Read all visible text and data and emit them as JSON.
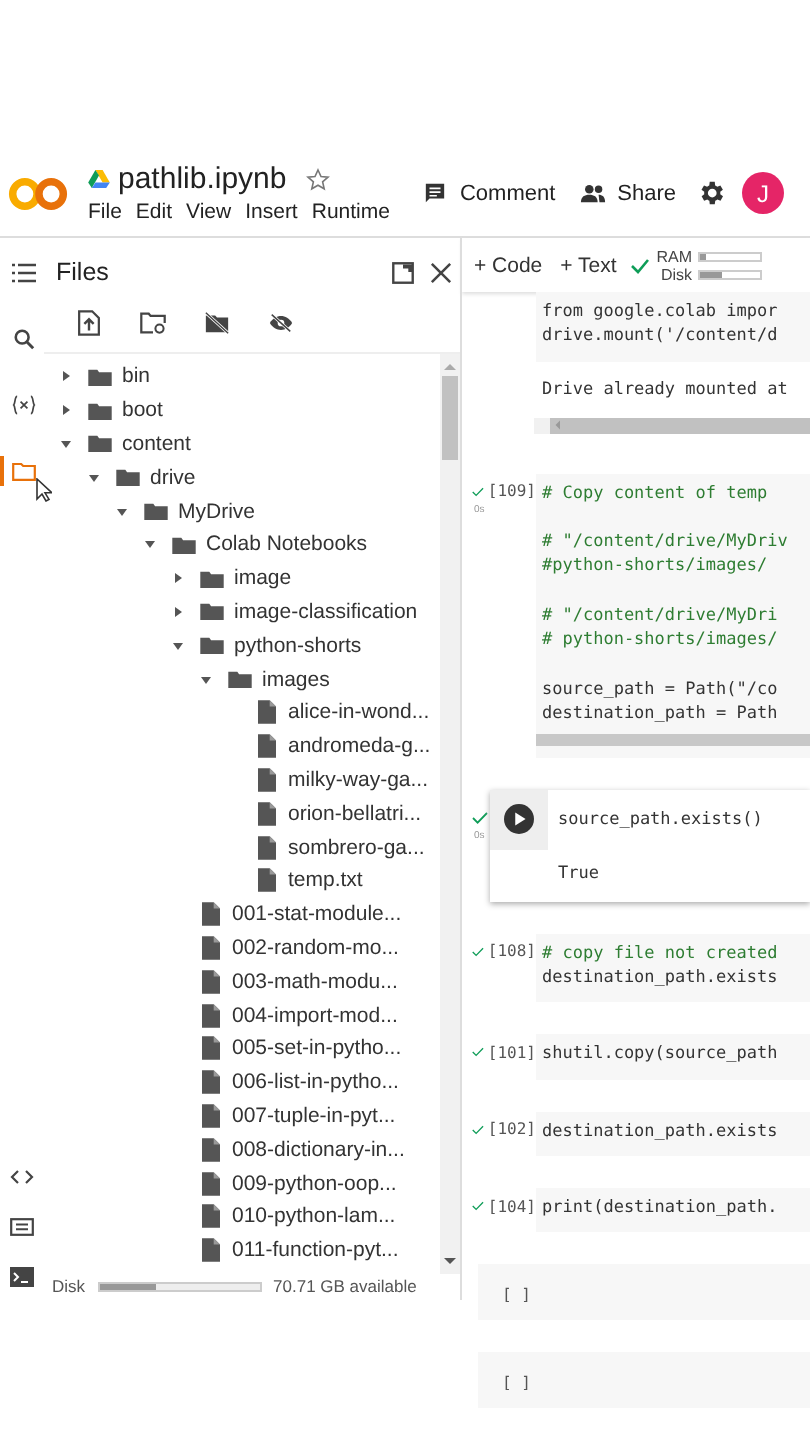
{
  "header": {
    "title": "pathlib.ipynb",
    "starred": false,
    "menu": [
      "File",
      "Edit",
      "View",
      "Insert",
      "Runtime"
    ],
    "comment": "Comment",
    "share": "Share",
    "avatar": "J"
  },
  "rail": [
    {
      "kind": "menu",
      "selected": false
    },
    {
      "kind": "search",
      "selected": false
    },
    {
      "kind": "variables",
      "selected": false
    },
    {
      "kind": "files",
      "selected": true
    }
  ],
  "rail_bottom": [
    {
      "kind": "code"
    },
    {
      "kind": "snippets"
    },
    {
      "kind": "terminal"
    }
  ],
  "files": {
    "title": "Files",
    "tree": [
      {
        "name": "bin",
        "kind": "folder",
        "expanded": false
      },
      {
        "name": "boot",
        "kind": "folder",
        "expanded": false
      },
      {
        "name": "content",
        "kind": "folder",
        "expanded": true,
        "children": [
          {
            "name": "drive",
            "kind": "folder",
            "expanded": true,
            "children": [
              {
                "name": "MyDrive",
                "kind": "folder",
                "expanded": true,
                "children": [
                  {
                    "name": "Colab Notebooks",
                    "kind": "folder",
                    "expanded": true,
                    "children": [
                      {
                        "name": "image",
                        "kind": "folder",
                        "expanded": false
                      },
                      {
                        "name": "image-classification",
                        "kind": "folder",
                        "expanded": false
                      },
                      {
                        "name": "python-shorts",
                        "kind": "folder",
                        "expanded": true,
                        "children": [
                          {
                            "name": "images",
                            "kind": "folder",
                            "expanded": true,
                            "children": [
                              {
                                "name": "alice-in-wond...",
                                "kind": "file"
                              },
                              {
                                "name": "andromeda-g...",
                                "kind": "file"
                              },
                              {
                                "name": "milky-way-ga...",
                                "kind": "file"
                              },
                              {
                                "name": "orion-bellatri...",
                                "kind": "file"
                              },
                              {
                                "name": "sombrero-ga...",
                                "kind": "file"
                              },
                              {
                                "name": "temp.txt",
                                "kind": "file"
                              }
                            ]
                          }
                        ]
                      },
                      {
                        "name": "001-stat-module...",
                        "kind": "file"
                      },
                      {
                        "name": "002-random-mo...",
                        "kind": "file"
                      },
                      {
                        "name": "003-math-modu...",
                        "kind": "file"
                      },
                      {
                        "name": "004-import-mod...",
                        "kind": "file"
                      },
                      {
                        "name": "005-set-in-pytho...",
                        "kind": "file"
                      },
                      {
                        "name": "006-list-in-pytho...",
                        "kind": "file"
                      },
                      {
                        "name": "007-tuple-in-pyt...",
                        "kind": "file"
                      },
                      {
                        "name": "008-dictionary-in...",
                        "kind": "file"
                      },
                      {
                        "name": "009-python-oop...",
                        "kind": "file"
                      },
                      {
                        "name": "010-python-lam...",
                        "kind": "file"
                      },
                      {
                        "name": "011-function-pyt...",
                        "kind": "file"
                      }
                    ]
                  }
                ]
              }
            ]
          }
        ]
      }
    ],
    "disk": {
      "label": "Disk",
      "level": 0.35,
      "free": "70.71 GB available"
    }
  },
  "toolbar": {
    "add_code": "+ Code",
    "add_text": "+ Text",
    "connected": true,
    "ram": {
      "label": "RAM",
      "level": 0.1
    },
    "disk": {
      "label": "Disk",
      "level": 0.35
    }
  },
  "cells": [
    {
      "kind": "continued",
      "lines": [
        {
          "kind": "code",
          "text": "from google.colab impor"
        },
        {
          "kind": "code",
          "text": "drive.mount('/content/d"
        }
      ],
      "output": "Drive already mounted at",
      "output_scroll": true
    },
    {
      "kind": "executed",
      "count": "[109]",
      "time": "0s",
      "lines": [
        {
          "kind": "comment",
          "text": "# Copy content of temp"
        },
        {
          "kind": "blank"
        },
        {
          "kind": "comment",
          "text": "# \"/content/drive/MyDriv"
        },
        {
          "kind": "comment",
          "text": "#python-shorts/images/"
        },
        {
          "kind": "blank"
        },
        {
          "kind": "comment",
          "text": "# \"/content/drive/MyDri"
        },
        {
          "kind": "comment",
          "text": "# python-shorts/images/"
        },
        {
          "kind": "blank"
        },
        {
          "kind": "code",
          "text": "source_path = Path(\"/co"
        },
        {
          "kind": "code",
          "text": "destination_path = Path"
        }
      ],
      "code_scroll": true
    },
    {
      "kind": "focused",
      "time": "0s",
      "lines": [
        {
          "kind": "code",
          "text": "source_path.exists()"
        }
      ],
      "output": "True"
    },
    {
      "kind": "executed",
      "count": "[108]",
      "lines": [
        {
          "kind": "comment",
          "text": "# copy file not created"
        },
        {
          "kind": "code",
          "text": "destination_path.exists"
        }
      ]
    },
    {
      "kind": "executed",
      "count": "[101]",
      "lines": [
        {
          "kind": "code",
          "text": "shutil.copy(source_path"
        }
      ]
    },
    {
      "kind": "executed",
      "count": "[102]",
      "lines": [
        {
          "kind": "code",
          "text": "destination_path.exists"
        }
      ]
    },
    {
      "kind": "executed",
      "count": "[104]",
      "lines": [
        {
          "kind": "code",
          "text": "print(destination_path."
        }
      ]
    },
    {
      "kind": "empty",
      "count": "[ ]"
    },
    {
      "kind": "empty",
      "count": "[ ]"
    }
  ]
}
